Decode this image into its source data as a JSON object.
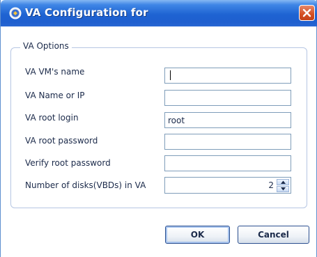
{
  "window": {
    "title": "VA Configuration for",
    "icon": "app-icon",
    "close_icon": "close-icon"
  },
  "group": {
    "legend": "VA Options"
  },
  "fields": [
    {
      "label": "VA VM's name",
      "value": "",
      "focused": true
    },
    {
      "label": "VA Name or IP",
      "value": ""
    },
    {
      "label": "VA root login",
      "value": "root"
    },
    {
      "label": "VA root password",
      "value": ""
    },
    {
      "label": "Verify root password",
      "value": ""
    }
  ],
  "disks": {
    "label": "Number of disks(VBDs) in VA",
    "value": "2"
  },
  "buttons": {
    "ok": "OK",
    "cancel": "Cancel"
  },
  "colors": {
    "titlebar": "#1f5fcf",
    "close_button": "#d44e22",
    "group_border": "#b6c6e3"
  }
}
